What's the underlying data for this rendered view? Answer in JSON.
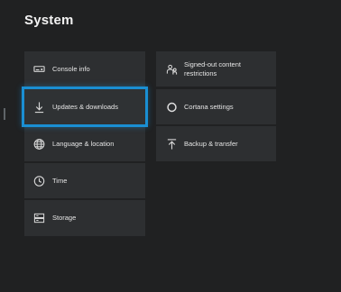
{
  "header": {
    "title": "System"
  },
  "left_column": {
    "tiles": [
      {
        "label": "Console info",
        "icon": "console-icon"
      },
      {
        "label": "Updates & downloads",
        "icon": "download-arrow-icon",
        "focused": true
      },
      {
        "label": "Language & location",
        "icon": "globe-icon"
      },
      {
        "label": "Time",
        "icon": "clock-icon"
      },
      {
        "label": "Storage",
        "icon": "storage-icon"
      }
    ]
  },
  "right_column": {
    "tiles": [
      {
        "label_line1": "Signed-out content",
        "label_line2": "restrictions",
        "icon": "family-icon"
      },
      {
        "label": "Cortana settings",
        "icon": "cortana-ring-icon"
      },
      {
        "label": "Backup & transfer",
        "icon": "upload-arrow-icon"
      }
    ]
  },
  "colors": {
    "background": "#202122",
    "tile": "#2d2f31",
    "focus_accent": "#1a8fd3",
    "text": "#e6e6e6"
  }
}
